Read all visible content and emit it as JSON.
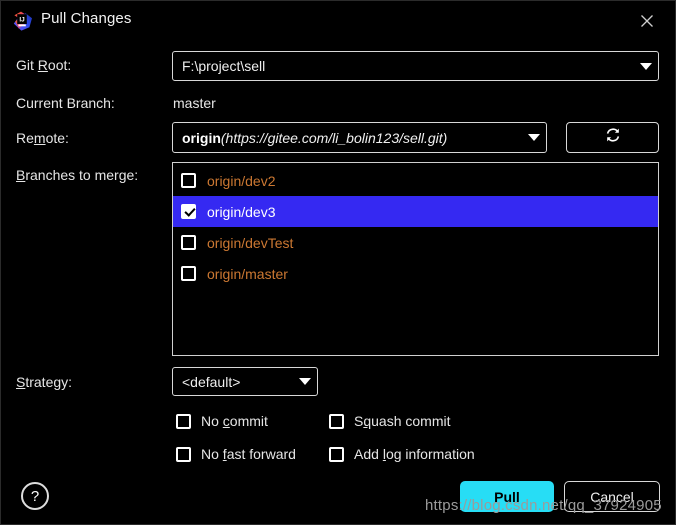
{
  "window": {
    "title": "Pull Changes",
    "app_icon": "intellij-idea-icon",
    "close_icon": "close-icon"
  },
  "form": {
    "git_root": {
      "label_pre": "Git ",
      "label_mnemonic": "R",
      "label_post": "oot:",
      "value": "F:\\project\\sell",
      "caret_icon": "chevron-down-icon"
    },
    "current_branch": {
      "label": "Current Branch:",
      "value": "master"
    },
    "remote": {
      "label_pre": "Re",
      "label_mnemonic": "m",
      "label_post": "ote:",
      "name": "origin",
      "url": "(https://gitee.com/li_bolin123/sell.git)",
      "caret_icon": "chevron-down-icon",
      "refresh_icon": "refresh-icon"
    },
    "branches": {
      "label_pre": "",
      "label_mnemonic": "B",
      "label_post": "ranches to merge:",
      "items": [
        {
          "label": "origin/dev2",
          "checked": false,
          "selected": false
        },
        {
          "label": "origin/dev3",
          "checked": true,
          "selected": true
        },
        {
          "label": "origin/devTest",
          "checked": false,
          "selected": false
        },
        {
          "label": "origin/master",
          "checked": false,
          "selected": false
        }
      ]
    },
    "strategy": {
      "label_pre": "",
      "label_mnemonic": "S",
      "label_post": "trategy:",
      "value": "<default>",
      "caret_icon": "chevron-down-icon"
    },
    "options": [
      {
        "pre": "No ",
        "mnemonic": "c",
        "post": "ommit",
        "checked": false
      },
      {
        "pre": "S",
        "mnemonic": "q",
        "post": "uash commit",
        "checked": false
      },
      {
        "pre": "No ",
        "mnemonic": "f",
        "post": "ast forward",
        "checked": false
      },
      {
        "pre": "Add ",
        "mnemonic": "l",
        "post": "og information",
        "checked": false
      }
    ]
  },
  "footer": {
    "help_label": "?",
    "pull_label": "Pull",
    "cancel_label": "Cancel"
  },
  "watermark": {
    "text": "https://blog.csdn.net/qq_37924905"
  },
  "colors": {
    "background": "#000000",
    "branch_text": "#cc7832",
    "selection": "#3529f2",
    "pull_button": "#27ddf5",
    "border": "#d8d8d8"
  }
}
